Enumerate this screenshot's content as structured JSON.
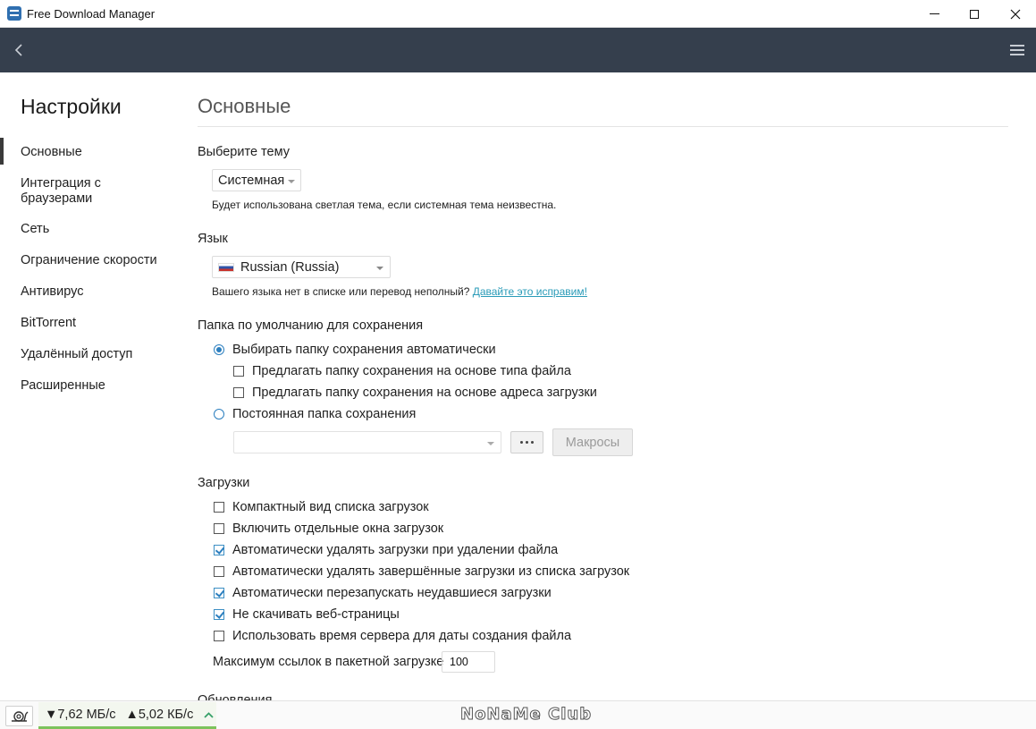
{
  "window": {
    "title": "Free Download Manager"
  },
  "sidebar": {
    "title": "Настройки",
    "items": [
      {
        "label": "Основные",
        "active": true
      },
      {
        "label": "Интеграция с браузерами"
      },
      {
        "label": "Сеть"
      },
      {
        "label": "Ограничение скорости"
      },
      {
        "label": "Антивирус"
      },
      {
        "label": "BitTorrent"
      },
      {
        "label": "Удалённый доступ"
      },
      {
        "label": "Расширенные"
      }
    ]
  },
  "main": {
    "title": "Основные",
    "theme": {
      "label": "Выберите тему",
      "value": "Системная",
      "hint": "Будет использована светлая тема, если системная тема неизвестна."
    },
    "language": {
      "label": "Язык",
      "value": "Russian (Russia)",
      "hint": "Вашего языка нет в списке или перевод неполный?",
      "link": "Давайте это исправим!"
    },
    "folder": {
      "label": "Папка по умолчанию для сохранения",
      "auto": {
        "label": "Выбирать папку сохранения автоматически",
        "selected": true
      },
      "by_type": {
        "label": "Предлагать папку сохранения на основе типа файла",
        "checked": false
      },
      "by_address": {
        "label": "Предлагать папку сохранения на основе адреса загрузки",
        "checked": false
      },
      "fixed": {
        "label": "Постоянная папка сохранения",
        "selected": false
      },
      "path_value": "",
      "macros_label": "Макросы"
    },
    "downloads": {
      "label": "Загрузки",
      "options": [
        {
          "label": "Компактный вид списка загрузок",
          "checked": false
        },
        {
          "label": "Включить отдельные окна загрузок",
          "checked": false
        },
        {
          "label": "Автоматически удалять загрузки при удалении файла",
          "checked": true
        },
        {
          "label": "Автоматически удалять завершённые загрузки из списка загрузок",
          "checked": false
        },
        {
          "label": "Автоматически перезапускать неудавшиеся загрузки",
          "checked": true
        },
        {
          "label": "Не скачивать веб-страницы",
          "checked": true
        },
        {
          "label": "Использовать время сервера для даты создания файла",
          "checked": false
        }
      ],
      "max_links_label": "Максимум ссылок в пакетной загрузке",
      "max_links_value": "100"
    },
    "updates_label": "Обновления"
  },
  "status": {
    "down_speed": "▼7,62 МБ/с",
    "up_speed": "▲5,02 КБ/с",
    "toggle_glyph": "^",
    "watermark": "NoNaMe Club"
  },
  "colors": {
    "toolbar": "#353f4d",
    "accent": "#2c7fbf",
    "link": "#2a9bb8",
    "speed_bar": "#7cc35b"
  },
  "icons": {
    "app": "fdm-logo-icon",
    "back": "chevron-left-icon",
    "menu": "hamburger-icon",
    "snail": "snail-icon",
    "toggle": "chevron-up-icon"
  }
}
